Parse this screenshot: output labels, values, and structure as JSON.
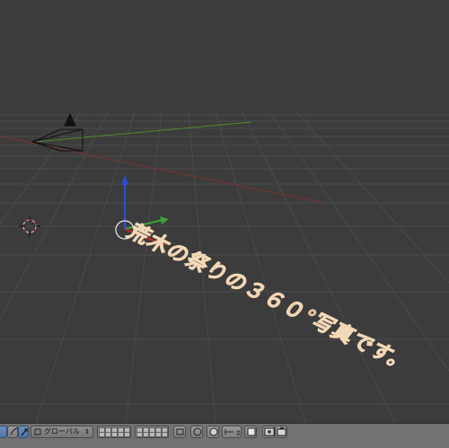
{
  "viewport": {
    "text_object": "荒木の祭りの３６０°写真です。",
    "colors": {
      "background": "#3c3c3c",
      "grid": "#4a4a4a",
      "axis_x": "#8a3a3a",
      "axis_y": "#4f8a2e",
      "text_fill": "#d9a67a",
      "text_outline": "#f4d9b8"
    }
  },
  "header": {
    "transform_orientation": "グローバル",
    "icons": [
      "view-menu-icon",
      "select-mode-icon",
      "pivot-icon",
      "layers-icon",
      "snap-icon",
      "proportional-edit-icon",
      "render-icon",
      "camera-icon"
    ]
  }
}
